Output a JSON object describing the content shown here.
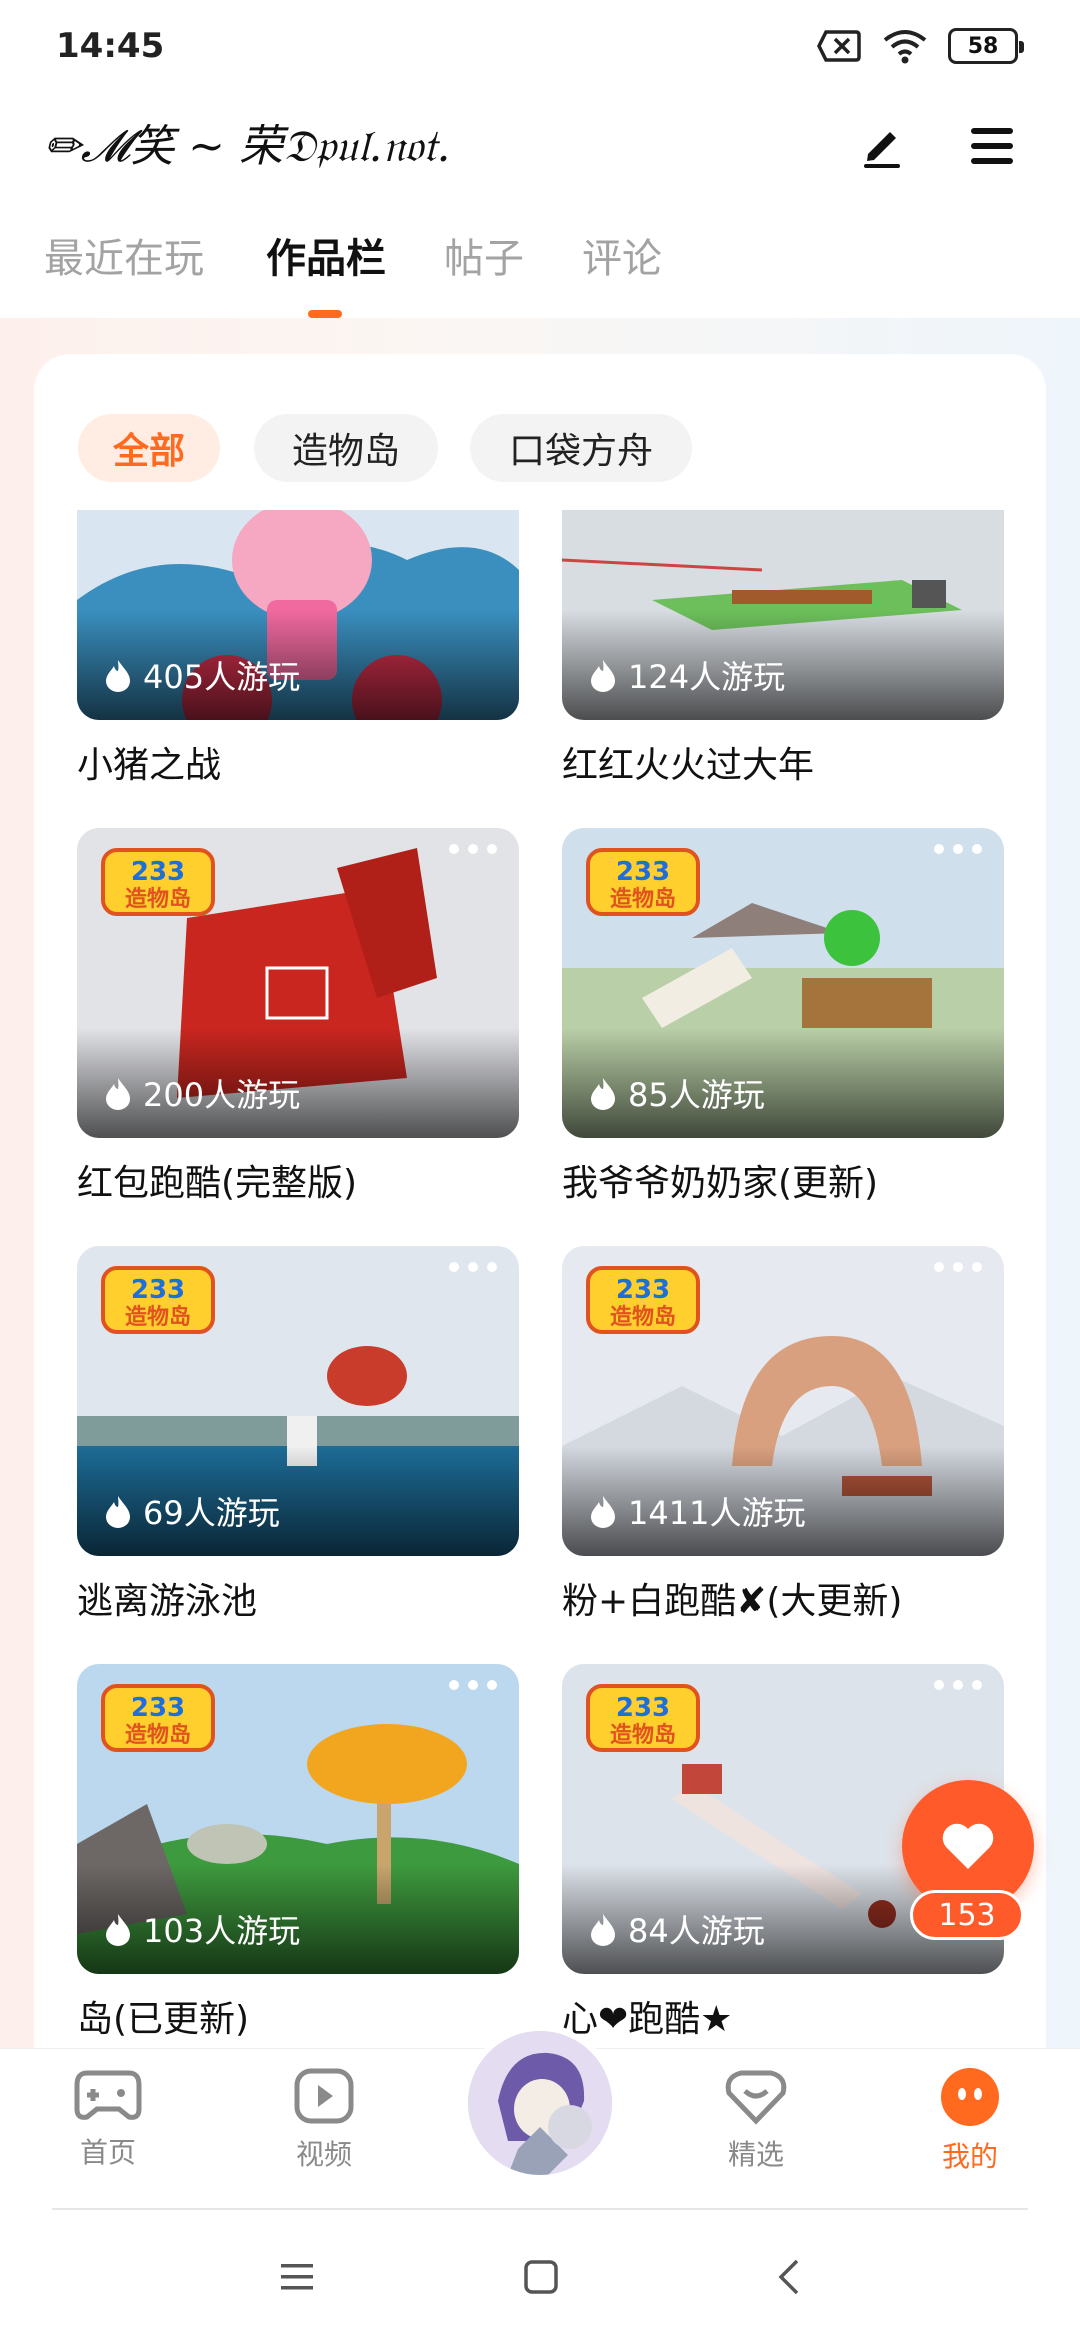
{
  "status_bar": {
    "time": "14:45",
    "battery": "58"
  },
  "header": {
    "username": "✏𝓜笑 ~ 荣𝔇𝔭𝔲𝔩.𝔫𝔬𝔱."
  },
  "tabs": [
    {
      "label": "最近在玩"
    },
    {
      "label": "作品栏"
    },
    {
      "label": "帖子"
    },
    {
      "label": "评论"
    }
  ],
  "filters": [
    {
      "label": "全部"
    },
    {
      "label": "造物岛"
    },
    {
      "label": "口袋方舟"
    }
  ],
  "works": [
    {
      "title": "小猪之战",
      "plays": "405人游玩"
    },
    {
      "title": "红红火火过大年",
      "plays": "124人游玩"
    },
    {
      "title": "红包跑酷(完整版)",
      "plays": "200人游玩"
    },
    {
      "title": "我爷爷奶奶家(更新)",
      "plays": "85人游玩"
    },
    {
      "title": "逃离游泳池",
      "plays": "69人游玩"
    },
    {
      "title": "粉+白跑酷✘(大更新)",
      "plays": "1411人游玩"
    },
    {
      "title": "岛(已更新)",
      "plays": "103人游玩"
    },
    {
      "title": "心❤跑酷★",
      "plays": "84人游玩"
    }
  ],
  "like": {
    "count": "153"
  },
  "bottom_nav": [
    {
      "label": "首页"
    },
    {
      "label": "视频"
    },
    {
      "label": "精选"
    },
    {
      "label": "我的"
    }
  ],
  "colors": {
    "accent": "#ff6a1f",
    "like": "#ff5b2a"
  }
}
